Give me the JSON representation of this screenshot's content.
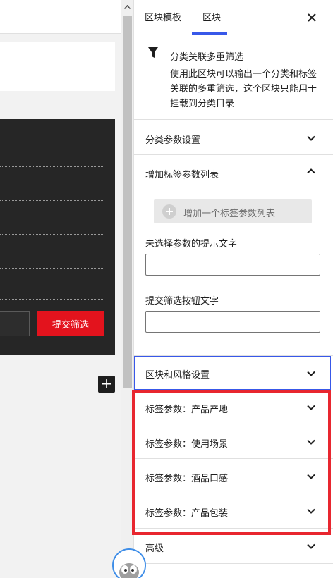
{
  "editor": {
    "submit_button_label": "提交筛选",
    "add_block_symbol": "+"
  },
  "sidebar": {
    "tabs": [
      {
        "label": "区块模板",
        "active": false
      },
      {
        "label": "区块",
        "active": true
      }
    ],
    "close_symbol": "×",
    "block_card": {
      "icon": "filter-icon",
      "title": "分类关联多重筛选",
      "description": "使用此区块可以输出一个分类和标签关联的多重筛选，这个区块只能用于挂载到分类目录"
    },
    "panels": {
      "category_params": {
        "title": "分类参数设置",
        "expanded": false
      },
      "tag_params_list": {
        "title": "增加标签参数列表",
        "expanded": true,
        "add_button_label": "增加一个标签参数列表",
        "unselected_hint_label": "未选择参数的提示文字",
        "unselected_hint_value": "",
        "submit_text_label": "提交筛选按钮文字",
        "submit_text_value": ""
      },
      "block_style": {
        "title": "区块和风格设置",
        "expanded": false
      },
      "tag_items": [
        {
          "title": "标签参数：产品产地"
        },
        {
          "title": "标签参数：使用场景"
        },
        {
          "title": "标签参数：酒品口感"
        },
        {
          "title": "标签参数：产品包装"
        }
      ],
      "advanced": {
        "title": "高级",
        "expanded": false
      }
    }
  },
  "colors": {
    "accent": "#3858e9",
    "submit_red": "#e3131d",
    "highlight_red": "#e8262f",
    "dark_block": "#262626"
  }
}
